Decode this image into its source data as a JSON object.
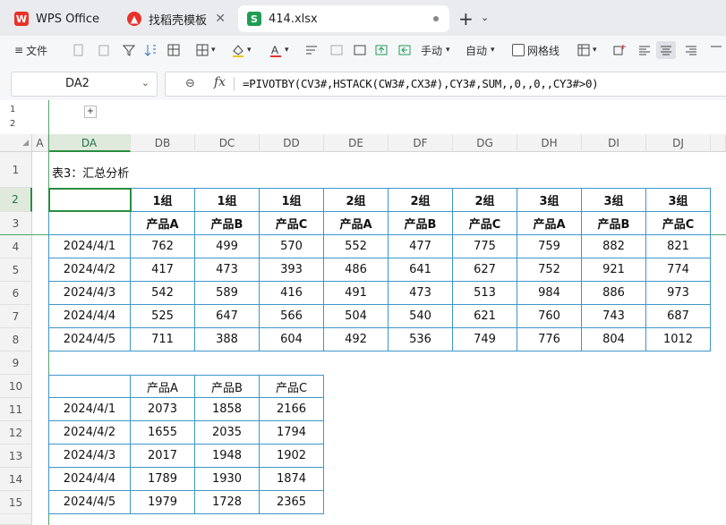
{
  "tabs": [
    {
      "label": "WPS Office"
    },
    {
      "label": "找稻壳模板"
    },
    {
      "label": "414.xlsx"
    }
  ],
  "toolbar": {
    "file_label": "文件",
    "manual_label": "手动",
    "auto_label": "自动",
    "gridlines_label": "网格线"
  },
  "namebox": {
    "value": "DA2"
  },
  "formula": "=PIVOTBY(CV3#,HSTACK(CW3#,CX3#),CY3#,SUM,,0,,0,,CY3#>0)",
  "outline_levels": [
    "1",
    "2"
  ],
  "columns": [
    "A",
    "DA",
    "DB",
    "DC",
    "DD",
    "DE",
    "DF",
    "DG",
    "DH",
    "DI",
    "DJ"
  ],
  "rows": [
    "1",
    "2",
    "3",
    "4",
    "5",
    "6",
    "7",
    "8",
    "9",
    "10",
    "11",
    "12",
    "13",
    "14",
    "15"
  ],
  "sheet": {
    "title": "表3：汇总分析",
    "table1": {
      "groups": [
        "1组",
        "1组",
        "1组",
        "2组",
        "2组",
        "2组",
        "3组",
        "3组",
        "3组"
      ],
      "products": [
        "产品A",
        "产品B",
        "产品C",
        "产品A",
        "产品B",
        "产品C",
        "产品A",
        "产品B",
        "产品C"
      ],
      "rows": [
        {
          "date": "2024/4/1",
          "values": [
            "762",
            "499",
            "570",
            "552",
            "477",
            "775",
            "759",
            "882",
            "821"
          ]
        },
        {
          "date": "2024/4/2",
          "values": [
            "417",
            "473",
            "393",
            "486",
            "641",
            "627",
            "752",
            "921",
            "774"
          ]
        },
        {
          "date": "2024/4/3",
          "values": [
            "542",
            "589",
            "416",
            "491",
            "473",
            "513",
            "984",
            "886",
            "973"
          ]
        },
        {
          "date": "2024/4/4",
          "values": [
            "525",
            "647",
            "566",
            "504",
            "540",
            "621",
            "760",
            "743",
            "687"
          ]
        },
        {
          "date": "2024/4/5",
          "values": [
            "711",
            "388",
            "604",
            "492",
            "536",
            "749",
            "776",
            "804",
            "1012"
          ]
        }
      ]
    },
    "table2": {
      "headers": [
        "产品A",
        "产品B",
        "产品C"
      ],
      "rows": [
        {
          "date": "2024/4/1",
          "values": [
            "2073",
            "1858",
            "2166"
          ]
        },
        {
          "date": "2024/4/2",
          "values": [
            "1655",
            "2035",
            "1794"
          ]
        },
        {
          "date": "2024/4/3",
          "values": [
            "2017",
            "1948",
            "1902"
          ]
        },
        {
          "date": "2024/4/4",
          "values": [
            "1789",
            "1930",
            "1874"
          ]
        },
        {
          "date": "2024/4/5",
          "values": [
            "1979",
            "1728",
            "2365"
          ]
        }
      ]
    }
  },
  "colors": {
    "accent": "#2a8c3e",
    "table_border": "#3d97c9",
    "wps_red": "#e8322a",
    "sheet_green": "#1f9d55"
  }
}
